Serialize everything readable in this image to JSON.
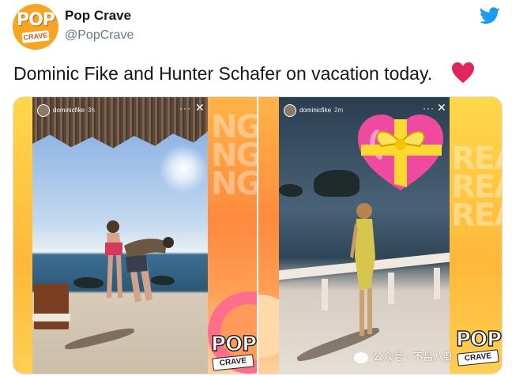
{
  "account": {
    "display_name": "Pop Crave",
    "handle": "@PopCrave",
    "avatar_text_top": "POP",
    "avatar_text_bottom": "CRAVE"
  },
  "tweet": {
    "text": "Dominic Fike and Hunter Schafer on vacation today.",
    "emoji": "red-heart-icon"
  },
  "media": {
    "story_left": {
      "username": "dominicfike",
      "time": "3h",
      "menu": "···",
      "close": "✕"
    },
    "story_right": {
      "username": "dominicfike",
      "time": "2m",
      "menu": "···",
      "close": "✕"
    },
    "watermark_logo_top": "POP",
    "watermark_logo_bottom": "CRAVE",
    "background_letters_left": "NG\nNG\nNG",
    "background_letters_right": "REA\nREA\nREA"
  },
  "overlay": {
    "wechat_text": "公众号 · 不吕八卦"
  },
  "colors": {
    "twitter_blue": "#1d9bf0",
    "brand_orange": "#f6a623",
    "heart_red": "#e0245e"
  }
}
